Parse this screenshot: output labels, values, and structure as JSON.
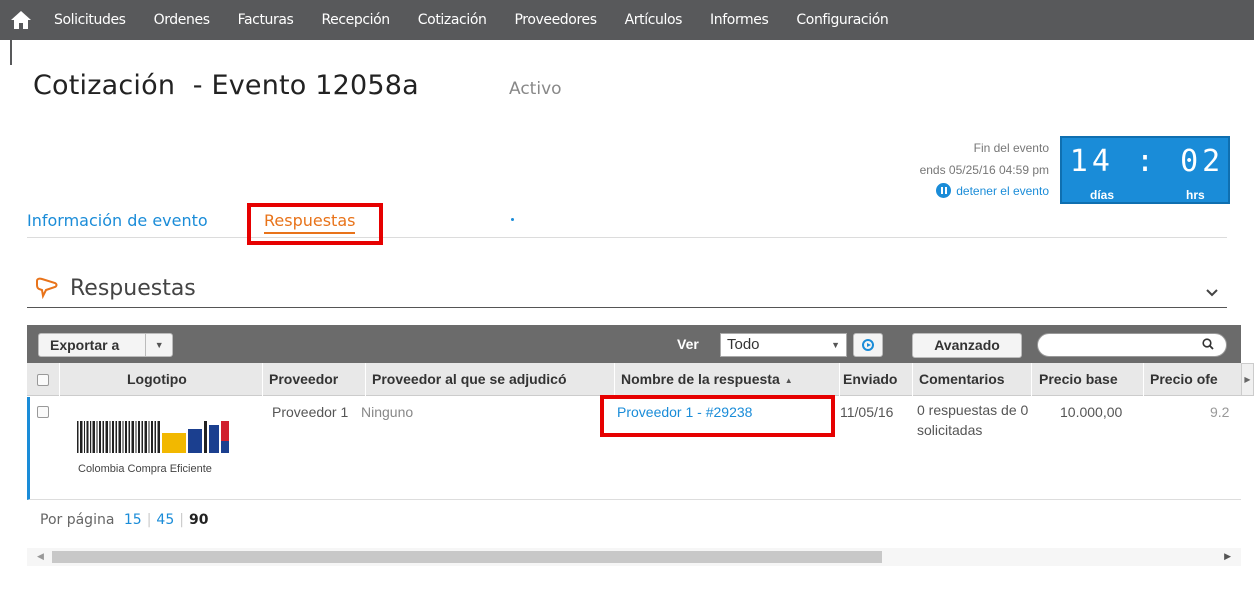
{
  "nav": {
    "home_icon": "home-icon",
    "items": [
      {
        "label": "Solicitudes"
      },
      {
        "label": "Ordenes"
      },
      {
        "label": "Facturas"
      },
      {
        "label": "Recepción"
      },
      {
        "label": "Cotización"
      },
      {
        "label": "Proveedores"
      },
      {
        "label": "Artículos"
      },
      {
        "label": "Informes"
      },
      {
        "label": "Configuración"
      }
    ]
  },
  "page": {
    "title": "Cotización  - Evento 12058a",
    "status": "Activo"
  },
  "countdown": {
    "end_label": "Fin del evento",
    "ends": "ends 05/25/16 04:59 pm",
    "stop_label": "detener el evento",
    "time": "14 : 02",
    "days_label": "días",
    "hrs_label": "hrs",
    "accent": "#1a8cd8"
  },
  "tabs": [
    {
      "label": "Información de evento"
    },
    {
      "label": "Respuestas"
    }
  ],
  "section": {
    "title": "Respuestas",
    "icon": "speech-bubble-icon"
  },
  "toolbar": {
    "export_label": "Exportar a",
    "ver_label": "Ver",
    "ver_value": "Todo",
    "advanced_label": "Avanzado",
    "search_placeholder": ""
  },
  "table": {
    "columns": [
      "Logotipo",
      "Proveedor",
      "Proveedor al que se adjudicó",
      "Nombre de la respuesta",
      "Enviado",
      "Comentarios",
      "Precio base",
      "Precio ofe"
    ],
    "rows": [
      {
        "logo_caption": "Colombia Compra Eficiente",
        "proveedor": "Proveedor 1",
        "adjudicado": "Ninguno",
        "nombre_respuesta": "Proveedor 1 - #29238",
        "enviado": "11/05/16",
        "comentarios": "0 respuestas de 0 solicitadas",
        "precio_base": "10.000,00",
        "precio_ofertado": "9.2"
      }
    ]
  },
  "pagination": {
    "label": "Por página",
    "options": [
      "15",
      "45",
      "90"
    ],
    "current": "90"
  },
  "colors": {
    "highlight": "#e60000",
    "active_tab": "#e8731a",
    "nav_bg": "#58595b"
  }
}
